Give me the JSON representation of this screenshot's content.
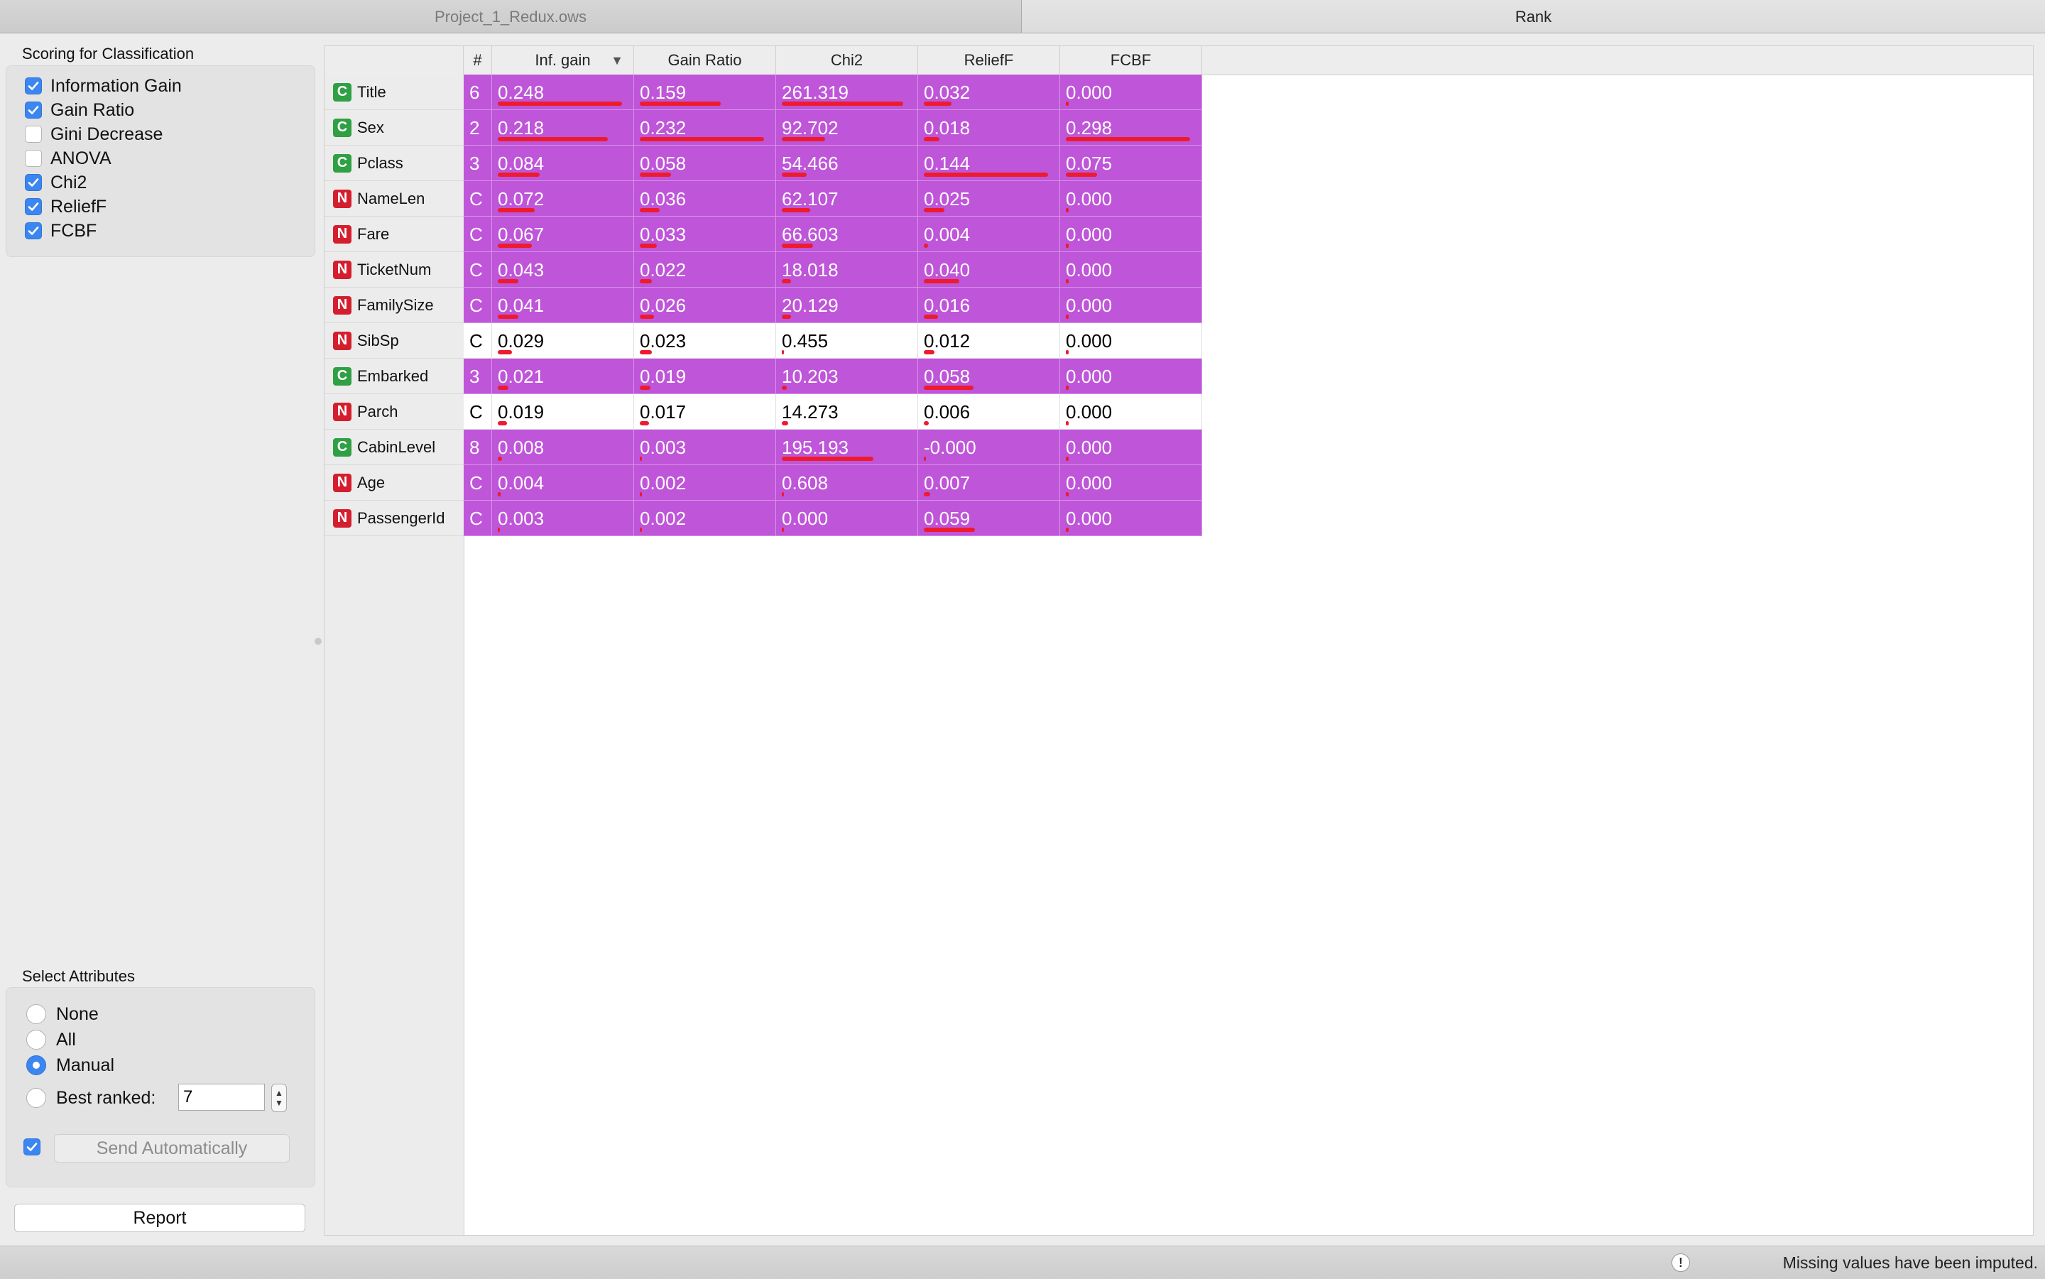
{
  "window": {
    "tabs": [
      {
        "label": "Project_1_Redux.ows",
        "active": false
      },
      {
        "label": "Rank",
        "active": true
      }
    ]
  },
  "scoring": {
    "title": "Scoring for Classification",
    "methods": [
      {
        "label": "Information Gain",
        "checked": true
      },
      {
        "label": "Gain Ratio",
        "checked": true
      },
      {
        "label": "Gini Decrease",
        "checked": false
      },
      {
        "label": "ANOVA",
        "checked": false
      },
      {
        "label": "Chi2",
        "checked": true
      },
      {
        "label": "ReliefF",
        "checked": true
      },
      {
        "label": "FCBF",
        "checked": true
      }
    ]
  },
  "select_attributes": {
    "title": "Select Attributes",
    "options": [
      {
        "label": "None",
        "selected": false
      },
      {
        "label": "All",
        "selected": false
      },
      {
        "label": "Manual",
        "selected": true
      },
      {
        "label": "Best ranked:",
        "selected": false
      }
    ],
    "best_ranked_value": "7",
    "send_automatically_checked": true,
    "send_label": "Send Automatically"
  },
  "report_label": "Report",
  "table": {
    "columns": [
      "#",
      "Inf. gain",
      "Gain Ratio",
      "Chi2",
      "ReliefF",
      "FCBF"
    ],
    "sorted_column": "Inf. gain",
    "highlight_color": "#bf55d9",
    "bar_color": "#ee1b2c",
    "rows": [
      {
        "type": "C",
        "name": "Title",
        "n": "6",
        "vals": [
          "0.248",
          "0.159",
          "261.319",
          "0.032",
          "0.000"
        ],
        "bars": [
          0.95,
          0.62,
          0.93,
          0.21,
          0.02
        ],
        "highlight": true
      },
      {
        "type": "C",
        "name": "Sex",
        "n": "2",
        "vals": [
          "0.218",
          "0.232",
          "92.702",
          "0.018",
          "0.298"
        ],
        "bars": [
          0.84,
          0.95,
          0.33,
          0.12,
          0.95
        ],
        "highlight": true
      },
      {
        "type": "C",
        "name": "Pclass",
        "n": "3",
        "vals": [
          "0.084",
          "0.058",
          "54.466",
          "0.144",
          "0.075"
        ],
        "bars": [
          0.32,
          0.24,
          0.19,
          0.95,
          0.24
        ],
        "highlight": true
      },
      {
        "type": "N",
        "name": "NameLen",
        "n": "C",
        "vals": [
          "0.072",
          "0.036",
          "62.107",
          "0.025",
          "0.000"
        ],
        "bars": [
          0.28,
          0.15,
          0.22,
          0.16,
          0.02
        ],
        "highlight": true
      },
      {
        "type": "N",
        "name": "Fare",
        "n": "C",
        "vals": [
          "0.067",
          "0.033",
          "66.603",
          "0.004",
          "0.000"
        ],
        "bars": [
          0.26,
          0.13,
          0.24,
          0.03,
          0.02
        ],
        "highlight": true
      },
      {
        "type": "N",
        "name": "TicketNum",
        "n": "C",
        "vals": [
          "0.043",
          "0.022",
          "18.018",
          "0.040",
          "0.000"
        ],
        "bars": [
          0.16,
          0.09,
          0.07,
          0.27,
          0.02
        ],
        "highlight": true
      },
      {
        "type": "N",
        "name": "FamilySize",
        "n": "C",
        "vals": [
          "0.041",
          "0.026",
          "20.129",
          "0.016",
          "0.000"
        ],
        "bars": [
          0.16,
          0.11,
          0.07,
          0.11,
          0.02
        ],
        "highlight": true
      },
      {
        "type": "N",
        "name": "SibSp",
        "n": "C",
        "vals": [
          "0.029",
          "0.023",
          "0.455",
          "0.012",
          "0.000"
        ],
        "bars": [
          0.11,
          0.09,
          0.01,
          0.08,
          0.02
        ],
        "highlight": false
      },
      {
        "type": "C",
        "name": "Embarked",
        "n": "3",
        "vals": [
          "0.021",
          "0.019",
          "10.203",
          "0.058",
          "0.000"
        ],
        "bars": [
          0.08,
          0.08,
          0.04,
          0.38,
          0.02
        ],
        "highlight": true
      },
      {
        "type": "N",
        "name": "Parch",
        "n": "C",
        "vals": [
          "0.019",
          "0.017",
          "14.273",
          "0.006",
          "0.000"
        ],
        "bars": [
          0.07,
          0.07,
          0.05,
          0.04,
          0.02
        ],
        "highlight": false
      },
      {
        "type": "C",
        "name": "CabinLevel",
        "n": "8",
        "vals": [
          "0.008",
          "0.003",
          "195.193",
          "-0.000",
          "0.000"
        ],
        "bars": [
          0.03,
          0.01,
          0.7,
          0.01,
          0.02
        ],
        "highlight": true
      },
      {
        "type": "N",
        "name": "Age",
        "n": "C",
        "vals": [
          "0.004",
          "0.002",
          "0.608",
          "0.007",
          "0.000"
        ],
        "bars": [
          0.02,
          0.01,
          0.01,
          0.05,
          0.02
        ],
        "highlight": true
      },
      {
        "type": "N",
        "name": "PassengerId",
        "n": "C",
        "vals": [
          "0.003",
          "0.002",
          "0.000",
          "0.059",
          "0.000"
        ],
        "bars": [
          0.01,
          0.01,
          0.0,
          0.39,
          0.02
        ],
        "highlight": true
      }
    ]
  },
  "status": {
    "message": "Missing values have been imputed.",
    "icon": "exclamation-icon"
  }
}
